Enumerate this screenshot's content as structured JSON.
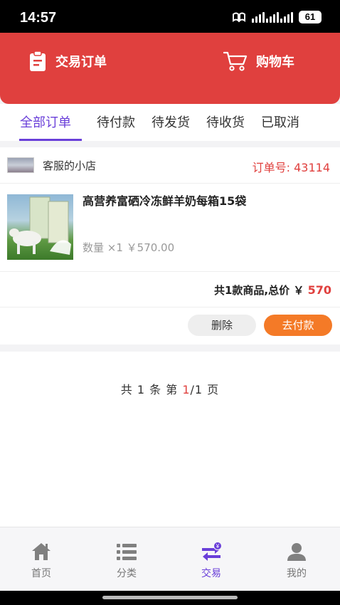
{
  "status_bar": {
    "time": "14:57",
    "battery": "61"
  },
  "header": {
    "orders_label": "交易订单",
    "cart_label": "购物车"
  },
  "tabs": [
    {
      "label": "全部订单",
      "active": true
    },
    {
      "label": "待付款",
      "active": false
    },
    {
      "label": "待发货",
      "active": false
    },
    {
      "label": "待收货",
      "active": false
    },
    {
      "label": "已取消",
      "active": false
    }
  ],
  "order": {
    "shop_name": "客服的小店",
    "order_no_label": "订单号:",
    "order_no": "43114",
    "product_title": "高营养富硒冷冻鲜羊奶每箱15袋",
    "quantity_text": "数量 ×1 ￥570.00",
    "total_text": "共1款商品,总价 ￥",
    "total_amount": "570",
    "delete_label": "删除",
    "pay_label": "去付款"
  },
  "pagination": {
    "prefix": "共 1 条 第 ",
    "current": "1",
    "suffix": "/1 页"
  },
  "bottom_nav": [
    {
      "label": "首页",
      "icon": "home-icon",
      "active": false
    },
    {
      "label": "分类",
      "icon": "list-icon",
      "active": false
    },
    {
      "label": "交易",
      "icon": "trade-icon",
      "active": true
    },
    {
      "label": "我的",
      "icon": "user-icon",
      "active": false
    }
  ],
  "colors": {
    "header_red": "#e0403e",
    "accent_purple": "#6a3fd9",
    "pay_orange": "#f47a27"
  }
}
